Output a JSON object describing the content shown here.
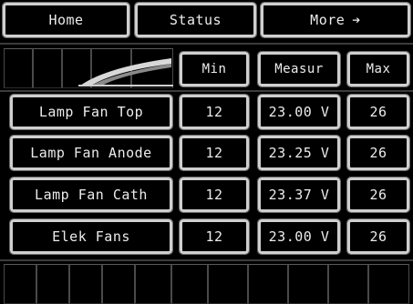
{
  "nav": {
    "home_label": "Home",
    "status_label": "Status",
    "more_label": "More",
    "more_arrow": "➔"
  },
  "table": {
    "headers": {
      "min": "Min",
      "measured": "Measur",
      "max": "Max"
    },
    "rows": [
      {
        "label": "Lamp Fan Top",
        "min": "12",
        "measured": "23.00 V",
        "max": "26"
      },
      {
        "label": "Lamp Fan Anode",
        "min": "12",
        "measured": "23.25 V",
        "max": "26"
      },
      {
        "label": "Lamp Fan Cath",
        "min": "12",
        "measured": "23.37 V",
        "max": "26"
      },
      {
        "label": "Elek Fans",
        "min": "12",
        "measured": "23.00 V",
        "max": "26"
      }
    ]
  },
  "colors": {
    "background": "#000000",
    "bevel": "#cfcfcf",
    "text": "#ececec"
  }
}
